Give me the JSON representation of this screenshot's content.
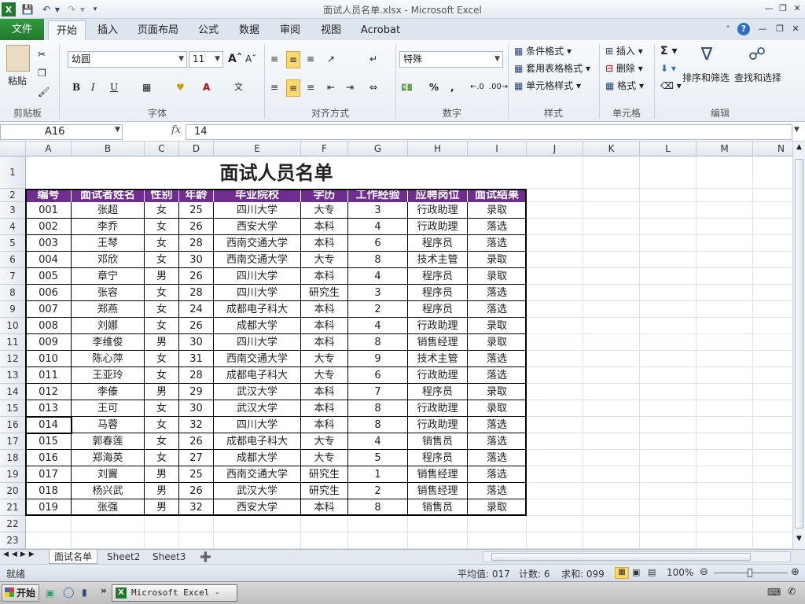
{
  "window": {
    "title": "面试人员名单.xlsx - Microsoft Excel"
  },
  "ribbon_tabs": [
    "文件",
    "开始",
    "插入",
    "页面布局",
    "公式",
    "数据",
    "审阅",
    "视图",
    "Acrobat"
  ],
  "ribbon": {
    "clipboard": {
      "paste": "粘贴",
      "label": "剪贴板"
    },
    "font": {
      "name": "幼圆",
      "size": "11",
      "bold": "B",
      "italic": "I",
      "underline": "U",
      "label": "字体"
    },
    "alignment": {
      "label": "对齐方式"
    },
    "number": {
      "format": "特殊",
      "percent": "%",
      "comma": ",",
      "label": "数字"
    },
    "styles": {
      "cond": "条件格式",
      "table": "套用表格格式",
      "cell": "单元格样式",
      "label": "样式"
    },
    "cells": {
      "insert": "插入",
      "delete": "删除",
      "format": "格式",
      "label": "单元格"
    },
    "editing": {
      "sort": "排序和筛选",
      "find": "查找和选择",
      "label": "编辑"
    }
  },
  "formula_bar": {
    "name_box": "A16",
    "fx": "fx",
    "value": "14"
  },
  "columns": [
    "A",
    "B",
    "C",
    "D",
    "E",
    "F",
    "G",
    "H",
    "I",
    "J",
    "K",
    "L",
    "M",
    "N"
  ],
  "rows": [
    "1",
    "2",
    "3",
    "4",
    "5",
    "6",
    "7",
    "8",
    "9",
    "10",
    "11",
    "12",
    "13",
    "14",
    "15",
    "16",
    "17",
    "18",
    "19",
    "20",
    "21",
    "22",
    "23"
  ],
  "table": {
    "title": "面试人员名单",
    "headers": [
      "编号",
      "面试者姓名",
      "性别",
      "年龄",
      "毕业院校",
      "学历",
      "工作经验",
      "应聘岗位",
      "面试结果"
    ],
    "rows": [
      [
        "001",
        "张超",
        "女",
        "25",
        "四川大学",
        "大专",
        "3",
        "行政助理",
        "录取"
      ],
      [
        "002",
        "李乔",
        "女",
        "26",
        "西安大学",
        "本科",
        "4",
        "行政助理",
        "落选"
      ],
      [
        "003",
        "王琴",
        "女",
        "28",
        "西南交通大学",
        "本科",
        "6",
        "程序员",
        "落选"
      ],
      [
        "004",
        "邓欣",
        "女",
        "30",
        "西南交通大学",
        "大专",
        "8",
        "技术主管",
        "录取"
      ],
      [
        "005",
        "章宁",
        "男",
        "26",
        "四川大学",
        "本科",
        "4",
        "程序员",
        "录取"
      ],
      [
        "006",
        "张容",
        "女",
        "28",
        "四川大学",
        "研究生",
        "3",
        "程序员",
        "落选"
      ],
      [
        "007",
        "郑燕",
        "女",
        "24",
        "成都电子科大",
        "本科",
        "2",
        "程序员",
        "落选"
      ],
      [
        "008",
        "刘娜",
        "女",
        "26",
        "成都大学",
        "本科",
        "4",
        "行政助理",
        "录取"
      ],
      [
        "009",
        "李维俊",
        "男",
        "30",
        "四川大学",
        "本科",
        "8",
        "销售经理",
        "录取"
      ],
      [
        "010",
        "陈心萍",
        "女",
        "31",
        "西南交通大学",
        "大专",
        "9",
        "技术主管",
        "落选"
      ],
      [
        "011",
        "王亚玲",
        "女",
        "28",
        "成都电子科大",
        "大专",
        "6",
        "行政助理",
        "落选"
      ],
      [
        "012",
        "李傣",
        "男",
        "29",
        "武汉大学",
        "本科",
        "7",
        "程序员",
        "录取"
      ],
      [
        "013",
        "王可",
        "女",
        "30",
        "武汉大学",
        "本科",
        "8",
        "行政助理",
        "录取"
      ],
      [
        "014",
        "马蓉",
        "女",
        "32",
        "四川大学",
        "本科",
        "8",
        "行政助理",
        "落选"
      ],
      [
        "015",
        "郭春莲",
        "女",
        "26",
        "成都电子科大",
        "大专",
        "4",
        "销售员",
        "落选"
      ],
      [
        "016",
        "郑海英",
        "女",
        "27",
        "成都大学",
        "大专",
        "5",
        "程序员",
        "落选"
      ],
      [
        "017",
        "刘竇",
        "男",
        "25",
        "西南交通大学",
        "研究生",
        "1",
        "销售经理",
        "落选"
      ],
      [
        "018",
        "杨兴武",
        "男",
        "26",
        "武汉大学",
        "研究生",
        "2",
        "销售经理",
        "落选"
      ],
      [
        "019",
        "张强",
        "男",
        "32",
        "西安大学",
        "本科",
        "8",
        "销售员",
        "录取"
      ]
    ]
  },
  "sheet_tabs": [
    "面试名单",
    "Sheet2",
    "Sheet3"
  ],
  "status": {
    "ready": "就绪",
    "average": "平均值: 017",
    "count": "计数: 6",
    "sum": "求和: 099",
    "zoom": "100%"
  },
  "taskbar": {
    "start": "开始",
    "app": "Microsoft Excel - ..."
  }
}
